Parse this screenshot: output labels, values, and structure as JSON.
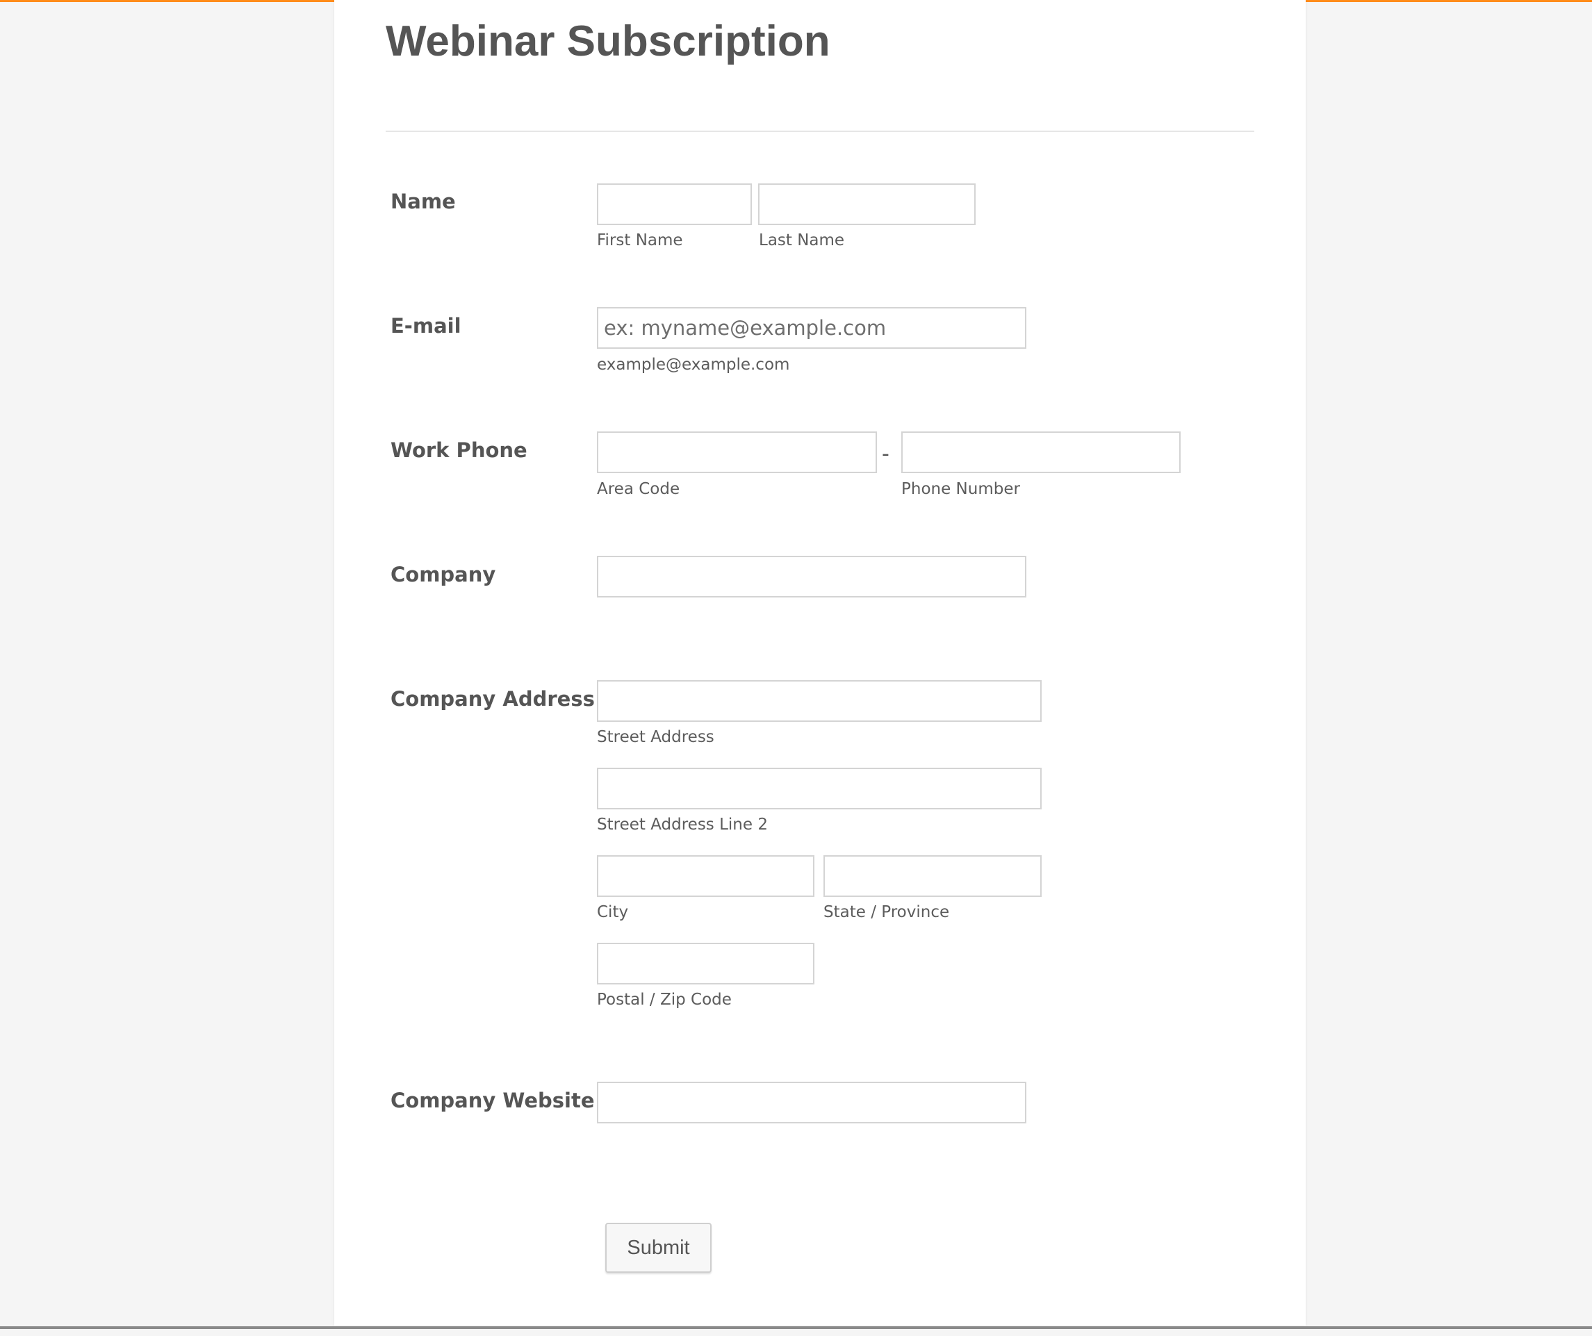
{
  "form": {
    "title": "Webinar Subscription",
    "submit_label": "Submit",
    "fields": {
      "name": {
        "label": "Name",
        "first_sublabel": "First Name",
        "last_sublabel": "Last Name"
      },
      "email": {
        "label": "E-mail",
        "placeholder": "ex: myname@example.com",
        "sublabel": "example@example.com"
      },
      "work_phone": {
        "label": "Work Phone",
        "separator": "-",
        "area_sublabel": "Area Code",
        "number_sublabel": "Phone Number"
      },
      "company": {
        "label": "Company"
      },
      "company_address": {
        "label": "Company Address",
        "street_sublabel": "Street Address",
        "street2_sublabel": "Street Address Line 2",
        "city_sublabel": "City",
        "state_sublabel": "State / Province",
        "postal_sublabel": "Postal / Zip Code"
      },
      "company_website": {
        "label": "Company Website"
      }
    }
  },
  "colors": {
    "accent": "#ff8c1a",
    "text": "#555555",
    "input_border": "#d4d4d4",
    "page_background": "#f5f5f5",
    "card_background": "#ffffff"
  }
}
